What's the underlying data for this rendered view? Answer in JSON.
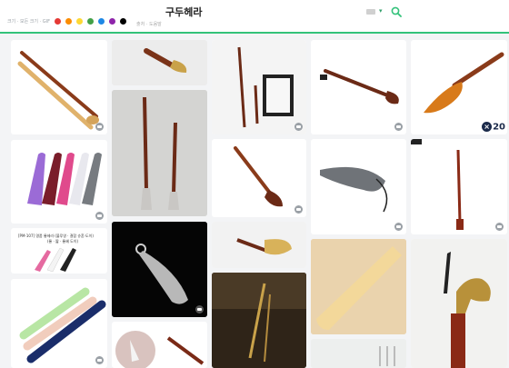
{
  "header": {
    "query_title": "구두헤라",
    "filter_text": "크기 · 모든 크기 · GIF",
    "sub_text": "출처 · 도움말",
    "colors": [
      "#e53935",
      "#fb8c00",
      "#fdd835",
      "#43a047",
      "#1e88e5",
      "#8e24aa",
      "#000000"
    ]
  },
  "results": {
    "poster_caption": "[PM-107] 명품 롱헤라 (블루영 · 결합 슈혼·도이)",
    "poster_caption2": "(롱 · 짧 · 롱혜 도이)",
    "badge_text": "20"
  }
}
